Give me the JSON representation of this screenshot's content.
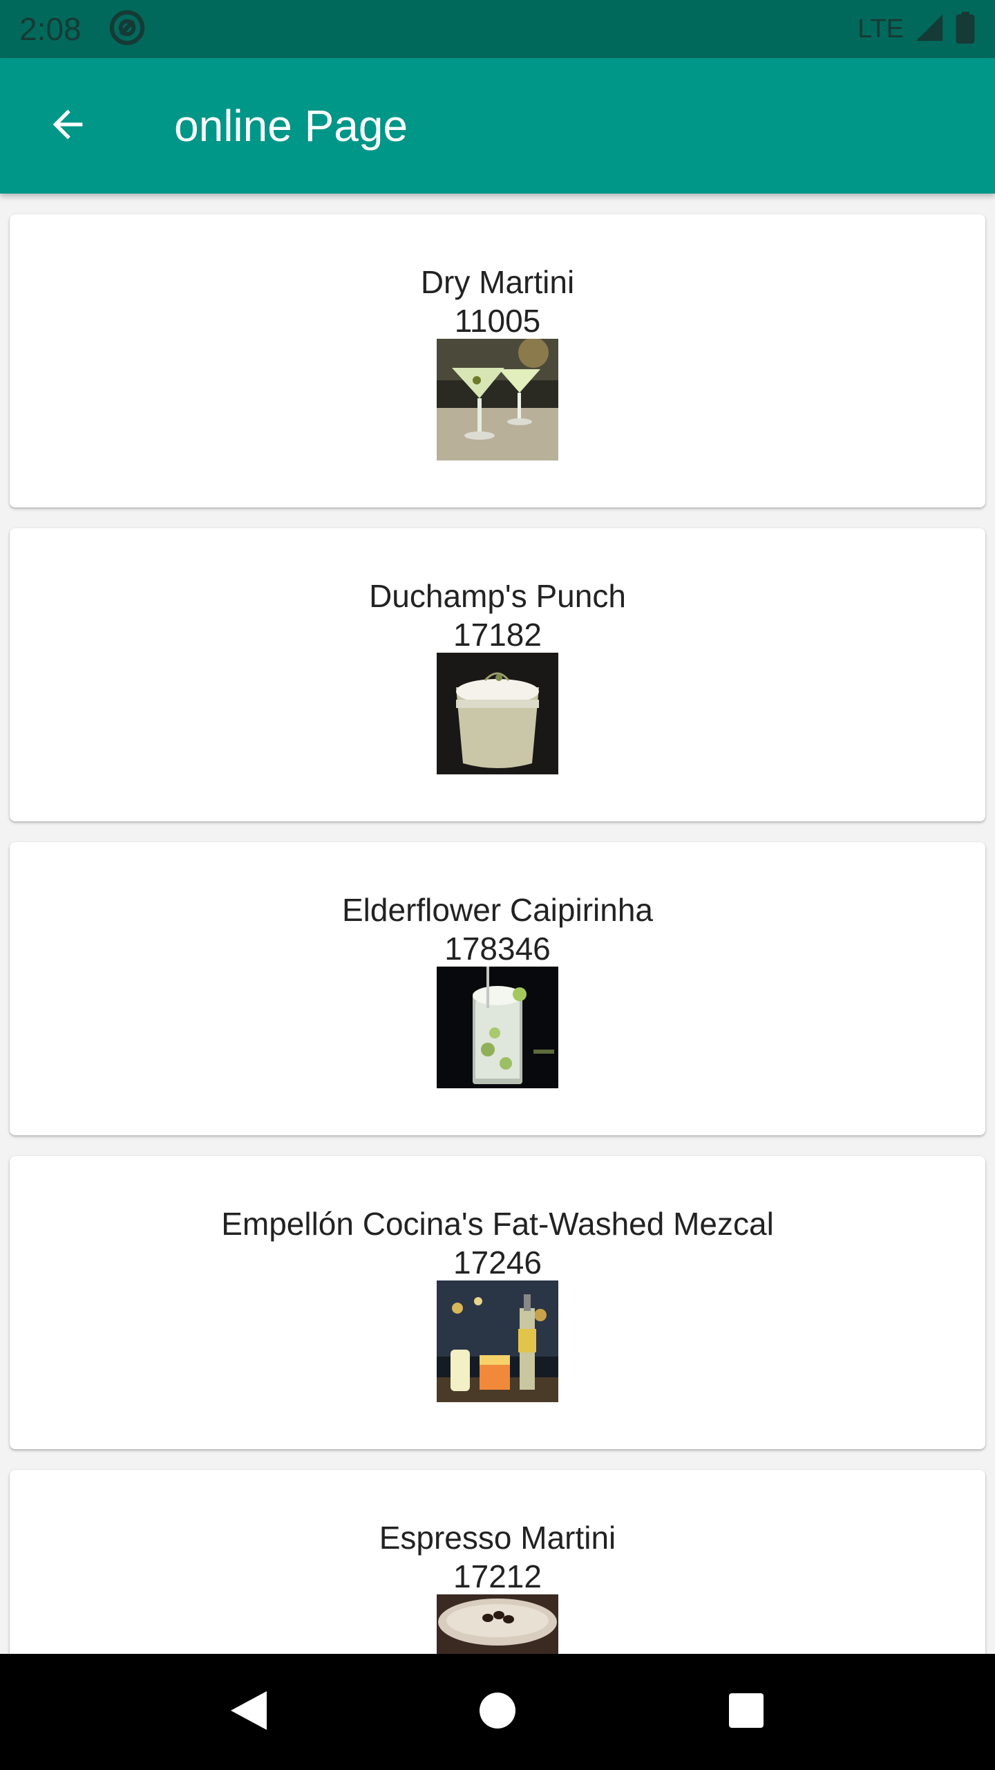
{
  "status": {
    "time": "2:08",
    "network": "LTE"
  },
  "appbar": {
    "title": "online Page"
  },
  "drinks": [
    {
      "name": "Dry Martini",
      "id": "11005"
    },
    {
      "name": "Duchamp's Punch",
      "id": "17182"
    },
    {
      "name": "Elderflower Caipirinha",
      "id": "178346"
    },
    {
      "name": "Empellón Cocina's Fat-Washed Mezcal",
      "id": "17246"
    },
    {
      "name": "Espresso Martini",
      "id": "17212"
    }
  ],
  "colors": {
    "statusbar": "#00695c",
    "appbar": "#009688",
    "background": "#f3f3f3"
  }
}
